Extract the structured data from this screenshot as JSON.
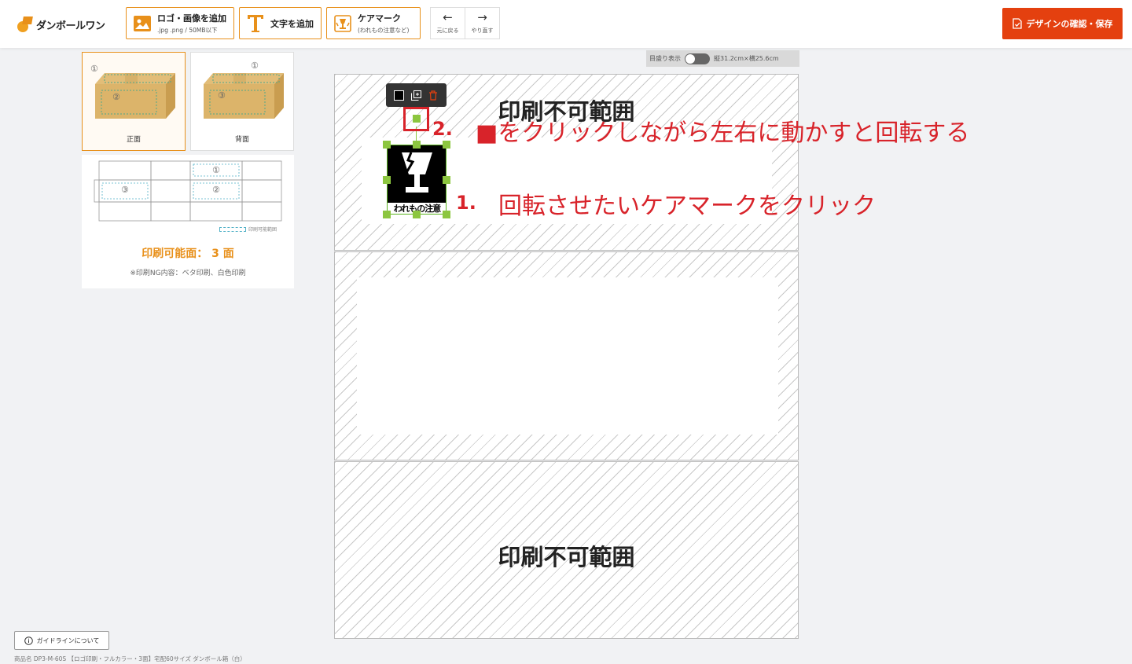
{
  "header": {
    "logo_text": "ダンボールワン",
    "add_logo": {
      "label": "ロゴ・画像を追加",
      "sub": ".jpg .png / 50MB以下"
    },
    "add_text": {
      "label": "文字を追加"
    },
    "care_mark": {
      "label": "ケアマーク",
      "sub": "(われもの注意など)"
    },
    "undo_label": "元に戻る",
    "redo_label": "やり直す",
    "save_label": "デザインの確認・保存",
    "accent_color": "#e8901a",
    "save_color": "#e4400f"
  },
  "sides": {
    "front": {
      "label": "正面",
      "num_top": "①",
      "num_center": "②"
    },
    "back": {
      "label": "背面",
      "num_top": "①",
      "num_center": "③"
    }
  },
  "diagram": {
    "nums": [
      "①",
      "③",
      "②"
    ],
    "legend": "印刷可能範囲",
    "title": "印刷可能面： 3 面",
    "note": "※印刷NG内容：ベタ印刷、白色印刷"
  },
  "canvas": {
    "scale_label": "目盛り表示",
    "dimensions": "縦31.2cm×横25.6cm",
    "no_print_label_top": "印刷不可範囲",
    "no_print_label_bottom": "印刷不可範囲",
    "caremark_text": "われもの注意"
  },
  "annotations": {
    "step1_num": "1.",
    "step1_text": "回転させたいケアマークをクリック",
    "step2_num": "2.",
    "step2_text": "■をクリックしながら左右に動かすと回転する",
    "color": "#d8232a"
  },
  "footer": {
    "guide_label": "ガイドラインについて",
    "product_name": "商品名 DP3-M-60S 【ロゴ印刷・フルカラー・3面】宅配60サイズ ダンボール箱（白）"
  }
}
